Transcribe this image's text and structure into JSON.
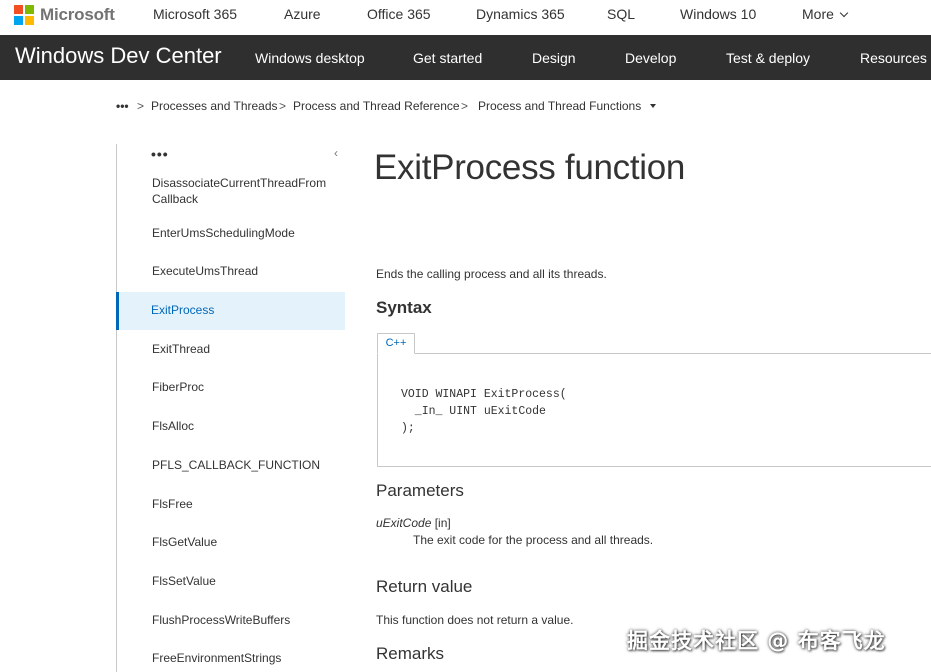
{
  "ms_header": {
    "logo_text": "Microsoft",
    "nav": [
      "Microsoft 365",
      "Azure",
      "Office 365",
      "Dynamics 365",
      "SQL",
      "Windows 10",
      "More"
    ]
  },
  "devcenter": {
    "title": "Windows Dev Center",
    "nav": [
      "Windows desktop",
      "Get started",
      "Design",
      "Develop",
      "Test & deploy",
      "Resources"
    ]
  },
  "breadcrumb": {
    "ellipsis": "•••",
    "items": [
      "Processes and Threads",
      "Process and Thread Reference",
      "Process and Thread Functions"
    ],
    "separator": ">"
  },
  "toc": {
    "ellipsis": "•••",
    "collapse_glyph": "‹",
    "items": [
      "DisassociateCurrentThreadFromCallback",
      "EnterUmsSchedulingMode",
      "ExecuteUmsThread",
      "ExitProcess",
      "ExitThread",
      "FiberProc",
      "FlsAlloc",
      "PFLS_CALLBACK_FUNCTION",
      "FlsFree",
      "FlsGetValue",
      "FlsSetValue",
      "FlushProcessWriteBuffers",
      "FreeEnvironmentStrings"
    ],
    "active_index": 3
  },
  "content": {
    "title": "ExitProcess function",
    "summary": "Ends the calling process and all its threads.",
    "syntax_heading": "Syntax",
    "code_tab": "C++",
    "code": "VOID WINAPI ExitProcess(\n  _In_ UINT uExitCode\n);",
    "parameters_heading": "Parameters",
    "param_name": "uExitCode",
    "param_dir": "[in]",
    "param_desc": "The exit code for the process and all threads.",
    "return_heading": "Return value",
    "return_text": "This function does not return a value.",
    "remarks_heading": "Remarks"
  },
  "watermark": "掘金技术社区 @ 布客飞龙",
  "colors": {
    "accent": "#0067b8",
    "dark_bar": "#2f2f2f",
    "active_bg": "#e4f2fb"
  }
}
